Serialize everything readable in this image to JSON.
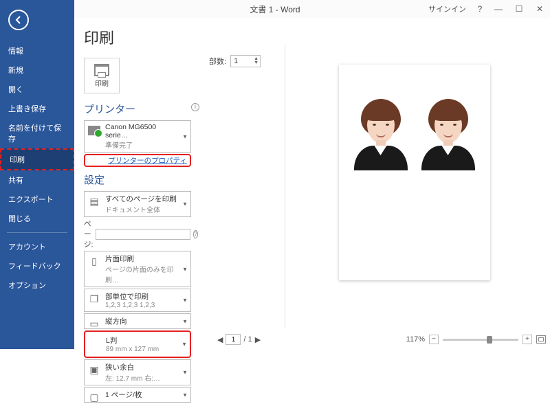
{
  "titlebar": {
    "title": "文書 1 - Word",
    "signin": "サインイン",
    "help": "?",
    "min": "—",
    "max": "☐",
    "close": "✕"
  },
  "sidebar": {
    "items": [
      {
        "label": "情報"
      },
      {
        "label": "新規"
      },
      {
        "label": "開く"
      },
      {
        "label": "上書き保存"
      },
      {
        "label": "名前を付けて保存"
      },
      {
        "label": "印刷"
      },
      {
        "label": "共有"
      },
      {
        "label": "エクスポート"
      },
      {
        "label": "閉じる"
      }
    ],
    "footer": [
      {
        "label": "アカウント"
      },
      {
        "label": "フィードバック"
      },
      {
        "label": "オプション"
      }
    ]
  },
  "page": {
    "heading": "印刷",
    "printbtn": "印刷",
    "copies_label": "部数:",
    "copies_value": "1"
  },
  "printer": {
    "section": "プリンター",
    "name": "Canon MG6500 serie…",
    "status": "準備完了",
    "properties_link": "プリンターのプロパティ"
  },
  "settings": {
    "section": "設定",
    "all_pages": {
      "t1": "すべてのページを印刷",
      "t2": "ドキュメント全体"
    },
    "pages_label": "ページ:",
    "one_side": {
      "t1": "片面印刷",
      "t2": "ページの片面のみを印刷…"
    },
    "collate": {
      "t1": "部単位で印刷",
      "t2": "1,2,3    1,2,3    1,2,3"
    },
    "orientation": {
      "t1": "縦方向"
    },
    "paper": {
      "t1": "L判",
      "t2": "89 mm x 127 mm"
    },
    "margins": {
      "t1": "狭い余白",
      "t2": "左: 12.7 mm    右:…"
    },
    "per_sheet": {
      "t1": "1 ページ/枚"
    }
  },
  "status": {
    "page_current": "1",
    "page_total": "/ 1",
    "zoom": "117%",
    "prev": "◀",
    "next": "▶",
    "minus": "−",
    "plus": "+"
  }
}
